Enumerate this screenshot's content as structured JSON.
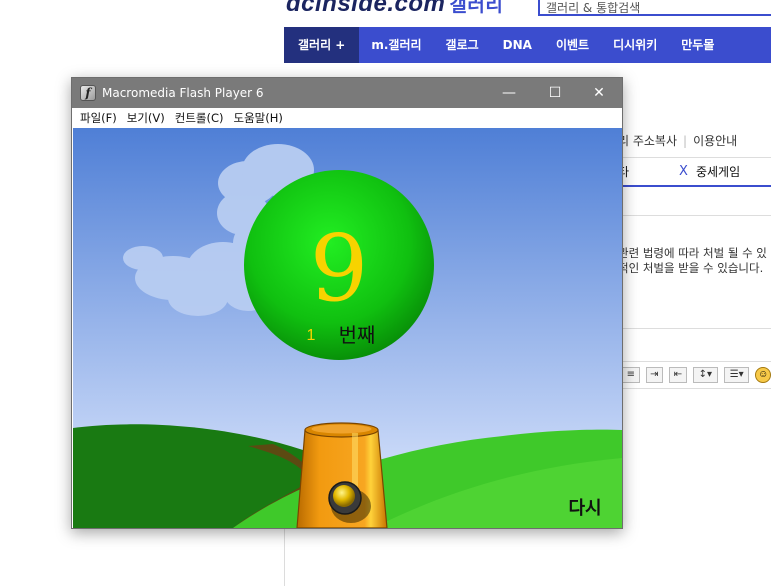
{
  "background_page": {
    "logo": "dcinside.com",
    "logo_sub": "갤러리",
    "search_placeholder": "갤러리 & 통합검색",
    "nav": [
      {
        "label": "갤러리 +"
      },
      {
        "label": "m.갤러리"
      },
      {
        "label": "갤로그"
      },
      {
        "label": "DNA"
      },
      {
        "label": "이벤트"
      },
      {
        "label": "디시위키"
      },
      {
        "label": "만두몰"
      }
    ],
    "links": {
      "copy_address": "리 주소복사",
      "usage_guide": "이용안내"
    },
    "tabs": {
      "left": "타",
      "close": "X",
      "active": "중세게임"
    },
    "warning_lines": [
      "관련 법령에 따라 처벌 될 수 있",
      "적인 처벌을 받을 수 있습니다."
    ]
  },
  "window": {
    "title": "Macromedia Flash Player 6",
    "controls": {
      "minimize": "—",
      "maximize": "☐",
      "close": "✕"
    },
    "menu": [
      "파일(F)",
      "보기(V)",
      "컨트롤(C)",
      "도움말(H)"
    ]
  },
  "game": {
    "ball_number": "9",
    "count": "1",
    "count_label": "번째",
    "retry_label": "다시",
    "colors": {
      "sky_top": "#4f7fd6",
      "sky_bottom": "#e2ebff",
      "ball": "#1ed81e",
      "ball_number": "#f7d300",
      "count": "#f7d300",
      "grass": "#3fc92a",
      "cannon": "#f29a10"
    }
  }
}
